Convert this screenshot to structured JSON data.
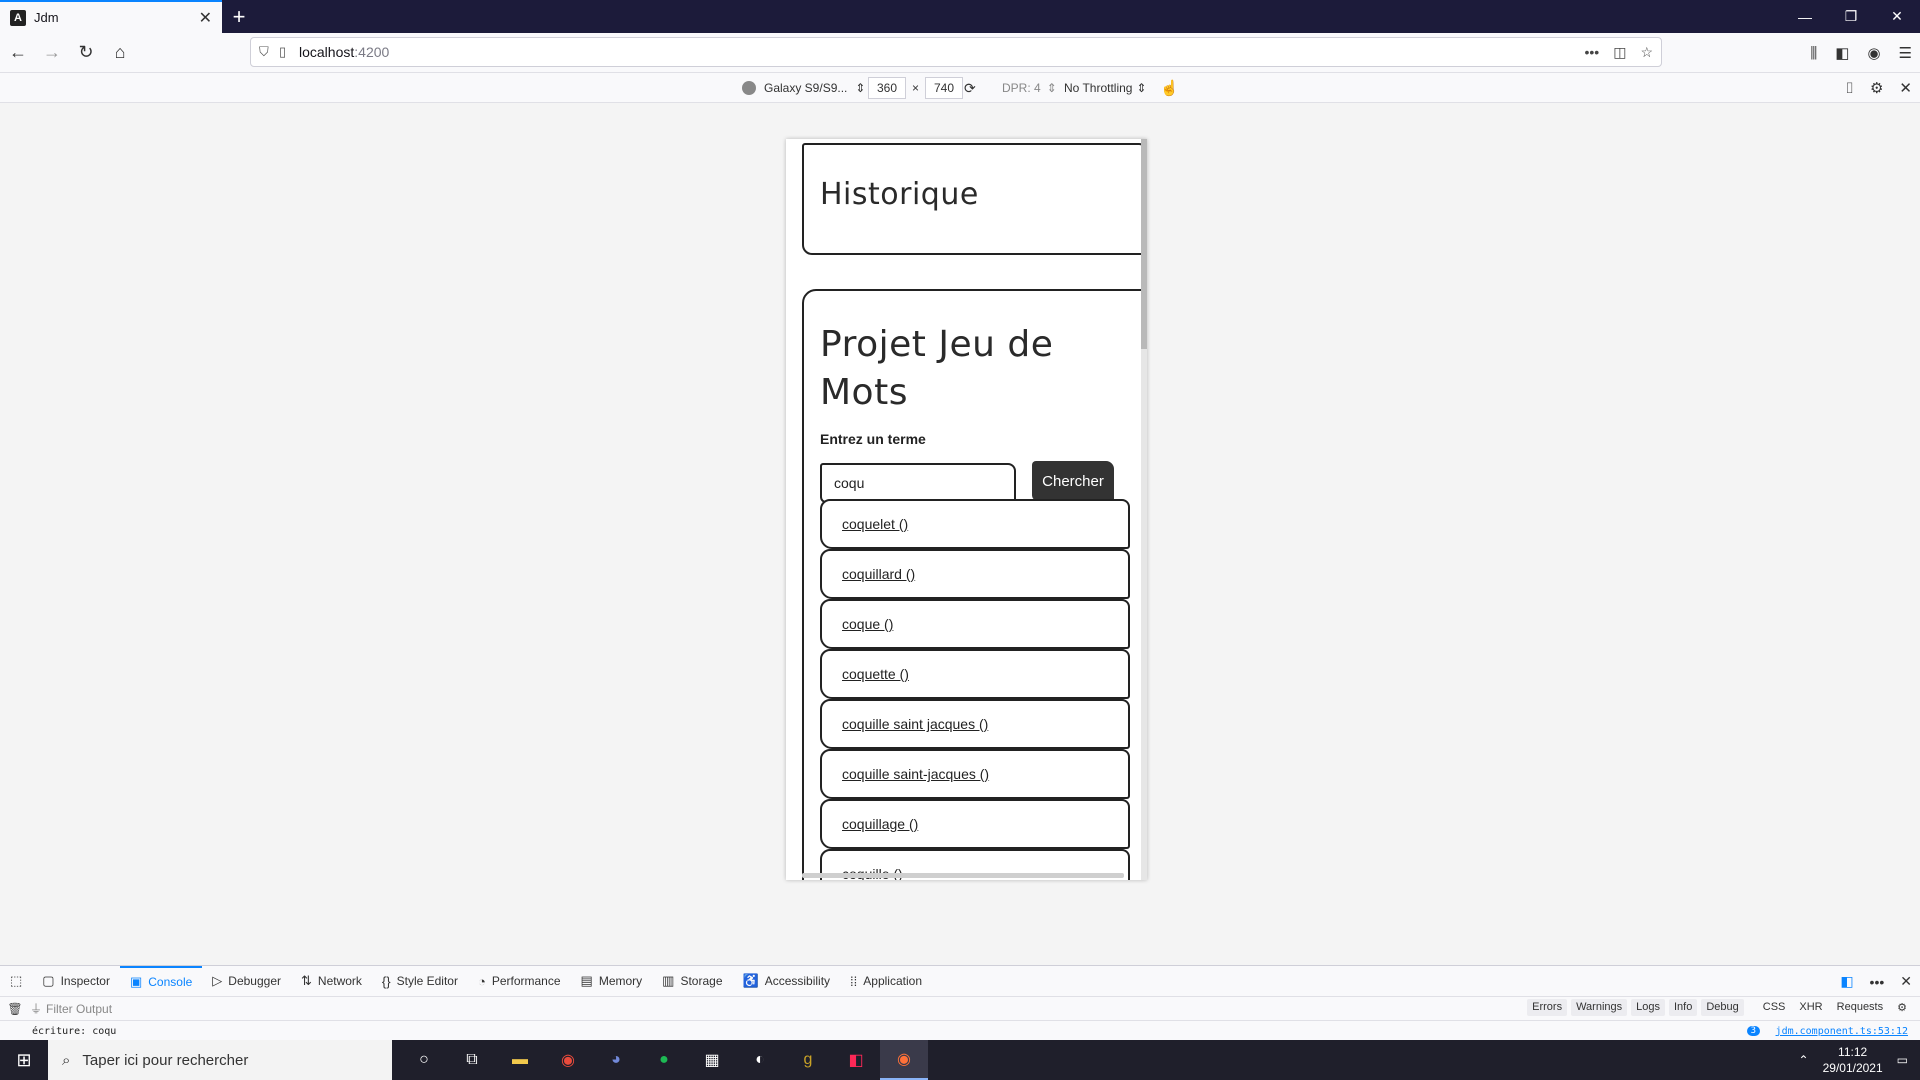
{
  "browser": {
    "tab_title": "Jdm",
    "url_host": "localhost",
    "url_port": ":4200"
  },
  "rdm": {
    "device": "Galaxy S9/S9...",
    "width": "360",
    "height": "740",
    "times": "×",
    "dpr": "DPR: 4",
    "throttling": "No Throttling"
  },
  "page": {
    "history_title": "Historique",
    "main_title": "Projet Jeu de Mots",
    "term_label": "Entrez un terme",
    "search_value": "coqu",
    "search_button": "Chercher",
    "suggestions": [
      "coquelet ()",
      "coquillard ()",
      "coque ()",
      "coquette ()",
      "coquille saint jacques ()",
      "coquille saint-jacques ()",
      "coquillage ()",
      "coquille ()"
    ]
  },
  "devtools": {
    "tabs": [
      "Inspector",
      "Console",
      "Debugger",
      "Network",
      "Style Editor",
      "Performance",
      "Memory",
      "Storage",
      "Accessibility",
      "Application"
    ],
    "active_tab": "Console",
    "filter_placeholder": "Filter Output",
    "filters": [
      "Errors",
      "Warnings",
      "Logs",
      "Info",
      "Debug"
    ],
    "filters_plain": [
      "CSS",
      "XHR",
      "Requests"
    ],
    "log_text": "écriture: coqu",
    "log_source": "jdm.component.ts:53:12",
    "log_count": "3"
  },
  "taskbar": {
    "search_placeholder": "Taper ici pour rechercher",
    "time": "11:12",
    "date": "29/01/2021"
  }
}
